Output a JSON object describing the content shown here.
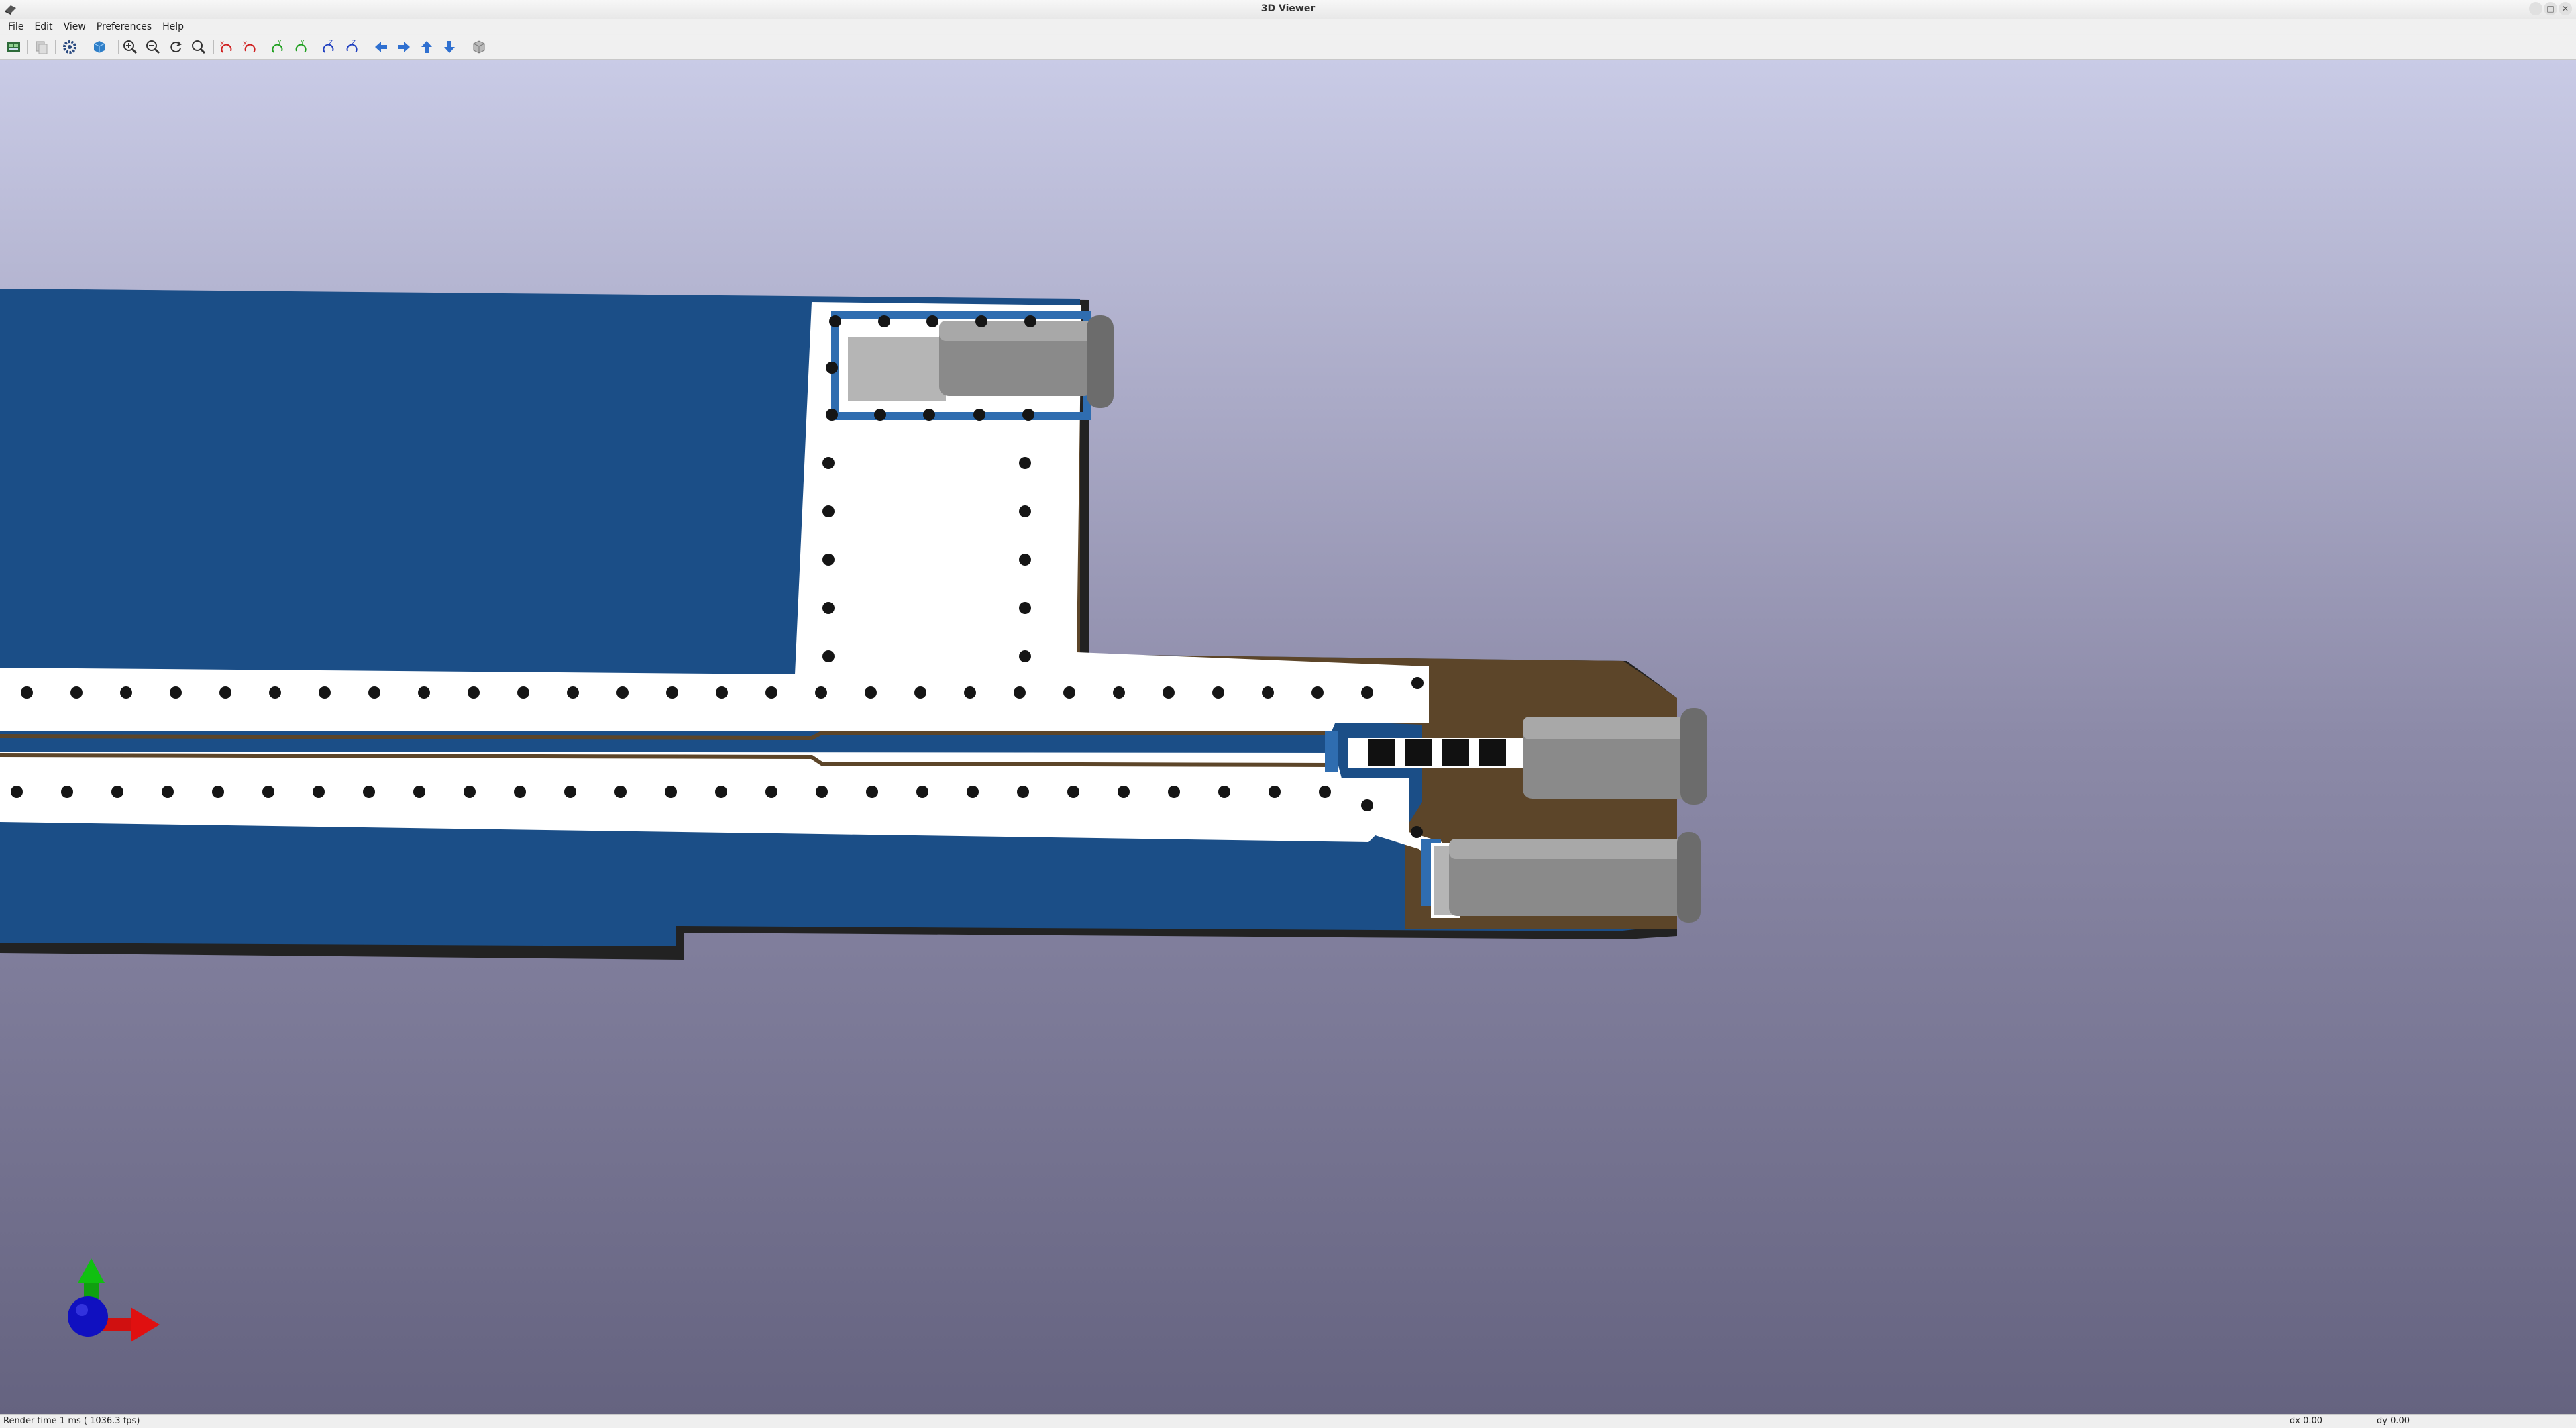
{
  "window": {
    "title": "3D Viewer"
  },
  "menu": {
    "items": [
      "File",
      "Edit",
      "View",
      "Preferences",
      "Help"
    ]
  },
  "toolbar": {
    "buttons": [
      "render-options-icon",
      "copy-image-icon",
      "settings-gear-icon",
      "raytracing-cube-icon",
      "zoom-in-icon",
      "zoom-out-icon",
      "redraw-icon",
      "zoom-fit-icon",
      "rotate-x-cw-icon",
      "rotate-x-ccw-icon",
      "rotate-y-cw-icon",
      "rotate-y-ccw-icon",
      "rotate-z-cw-icon",
      "rotate-z-ccw-icon",
      "pan-left-icon",
      "pan-right-icon",
      "pan-up-icon",
      "pan-down-icon",
      "orthographic-cube-icon"
    ]
  },
  "colors": {
    "board": "#1b4e87",
    "silkscreen": "#ffffff",
    "substrate": "#5c4529",
    "edge": "#222222",
    "pad": "#b5b5b5",
    "connector": "#8a8a8a",
    "axis_x": "#e01010",
    "axis_y": "#10c010",
    "axis_z": "#1010d0"
  },
  "status": {
    "render_time": "Render time 1 ms ( 1036.3 fps)",
    "dx": "dx 0.00",
    "dy": "dy 0.00"
  }
}
